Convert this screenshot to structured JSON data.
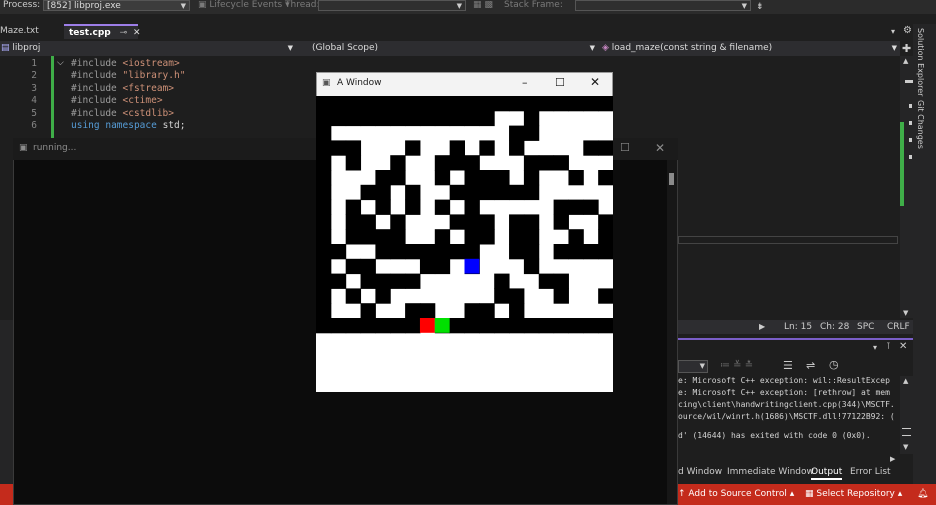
{
  "toolbar": {
    "process_label": "Process:",
    "process_value": "[852] libproj.exe",
    "lifecycle_label": "Lifecycle Events",
    "thread_label": "Thread:",
    "stackframe_label": "Stack Frame:"
  },
  "tabs": [
    {
      "label": "Maze.txt",
      "active": false
    },
    {
      "label": "test.cpp",
      "active": true
    }
  ],
  "navbar": {
    "project": "libproj",
    "scope": "(Global Scope)",
    "member": "load_maze(const string & filename)"
  },
  "editor": {
    "lines": [
      {
        "num": "1",
        "directive": "#include",
        "arg": "<iostream>"
      },
      {
        "num": "2",
        "directive": "#include",
        "arg": "\"library.h\""
      },
      {
        "num": "3",
        "directive": "#include",
        "arg": "<fstream>"
      },
      {
        "num": "4",
        "directive": "#include",
        "arg": "<ctime>"
      },
      {
        "num": "5",
        "directive": "#include",
        "arg": "<cstdlib>"
      },
      {
        "num": "6",
        "kw1": "using",
        "kw2": "namespace",
        "rest": "std;"
      }
    ]
  },
  "console": {
    "title": "running..."
  },
  "maze_window": {
    "title": "A Window",
    "minimize_icon": "minimize-icon",
    "maximize_icon": "maximize-icon",
    "close_icon": "close-icon",
    "grid": {
      "cols": 20,
      "rows": 20,
      "cells": [
        "11111111111111111111",
        "11111111111100100000",
        "10000000000001100000",
        "11100010010101000011",
        "10100100111000111000",
        "10001100101110100101",
        "10011010011111100000",
        "10101010101000001110",
        "10110100011101101001",
        "10111100101101100101",
        "11001111111001101111",
        "10110001101000100000",
        "11011110000010011000",
        "10101000000011001001",
        "10010011001101000000",
        "11111110111111111111",
        "00000000000000000000",
        "00000000000000000000",
        "00000000000000000000",
        "00000000000000000000"
      ],
      "markers": [
        {
          "row": 11,
          "col": 10,
          "color": "#0000ff"
        },
        {
          "row": 15,
          "col": 7,
          "color": "#ff0000"
        },
        {
          "row": 15,
          "col": 8,
          "color": "#00e000"
        }
      ]
    }
  },
  "status_line": {
    "ln": "Ln: 15",
    "ch": "Ch: 28",
    "spc": "SPC",
    "crlf": "CRLF"
  },
  "output": {
    "lines": [
      "e: Microsoft C++ exception: wil::ResultExcep",
      "e: Microsoft C++ exception: [rethrow] at mem",
      "cing\\client\\handwritingclient.cpp(344)\\MSCTF.",
      "ource/wil/winrt.h(1686)\\MSCTF.dll!77122B92: (",
      "",
      "d' (14644) has exited with code 0 (0x0)."
    ]
  },
  "bottom_tabs": [
    "d Window",
    "Immediate Window",
    "Output",
    "Error List"
  ],
  "right_strip": [
    "Solution Explorer",
    "Git Changes"
  ],
  "statusbar": {
    "add_source_control": "Add to Source Control",
    "select_repository": "Select Repository"
  },
  "colors": {
    "accent_purple": "#7a5ec8",
    "status_red": "#c42b1c",
    "gutter_green": "#3fae48"
  }
}
